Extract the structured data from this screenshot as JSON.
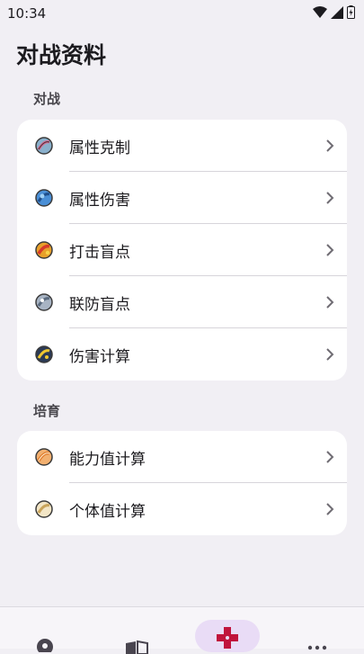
{
  "status_bar": {
    "time": "10:34"
  },
  "page": {
    "title": "对战资料"
  },
  "sections": [
    {
      "label": "对战",
      "items": [
        {
          "label": "属性克制",
          "icon": "psychic-ball-icon"
        },
        {
          "label": "属性伤害",
          "icon": "water-ball-icon"
        },
        {
          "label": "打击盲点",
          "icon": "fire-ball-icon"
        },
        {
          "label": "联防盲点",
          "icon": "steel-ball-icon"
        },
        {
          "label": "伤害计算",
          "icon": "thunder-ball-icon"
        }
      ]
    },
    {
      "label": "培育",
      "items": [
        {
          "label": "能力值计算",
          "icon": "orange-ball-icon"
        },
        {
          "label": "个体值计算",
          "icon": "cream-ball-icon"
        }
      ]
    }
  ],
  "colors": {
    "background": "#f1eff4",
    "card": "#ffffff",
    "accent": "#c0143c",
    "pill": "#e9dcf6"
  }
}
